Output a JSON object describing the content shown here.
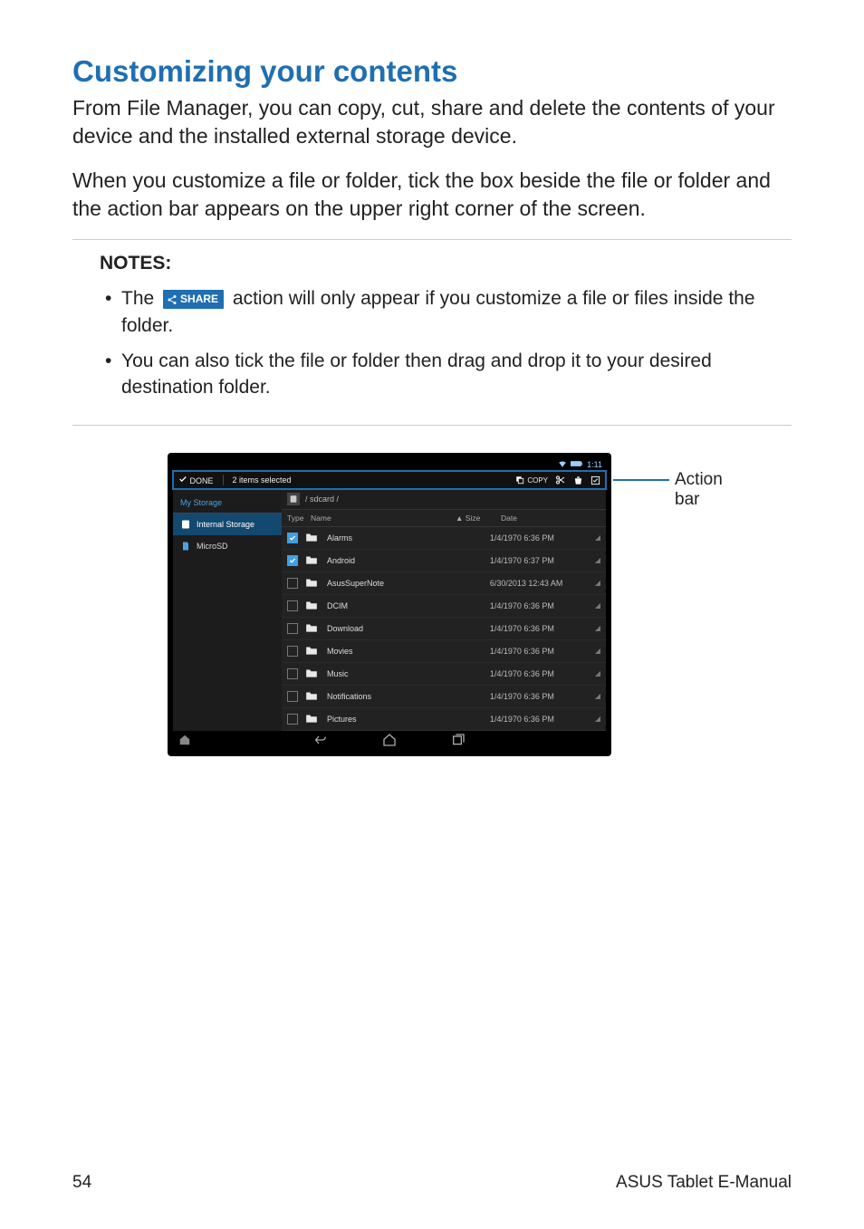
{
  "heading": "Customizing your contents",
  "para1": "From File Manager, you can copy, cut, share and delete the contents of your device and the installed external storage device.",
  "para2": "When you customize a file or folder, tick the box beside the file or folder and the action bar appears on the upper right corner of the screen.",
  "notes": {
    "title": "NOTES:",
    "bullet": "•",
    "n1a": "The",
    "share_btn": "SHARE",
    "n1b": "action will only appear if you customize a file or files inside the folder.",
    "n2": "You can also tick the file or folder then drag and drop it to your desired destination folder."
  },
  "callout": "Action bar",
  "device": {
    "status_time": "1:11",
    "sel_done": "DONE",
    "sel_count": "2 items selected",
    "act_copy": "COPY",
    "side_title": "My Storage",
    "side_internal": "Internal Storage",
    "side_sd": "MicroSD",
    "path": "/ sdcard /",
    "hdr_type": "Type",
    "hdr_name": "Name",
    "hdr_size": "Size",
    "hdr_date": "Date",
    "sort_caret": "▲",
    "rows": [
      {
        "checked": true,
        "name": "Alarms",
        "date": "1/4/1970 6:36 PM"
      },
      {
        "checked": true,
        "name": "Android",
        "date": "1/4/1970 6:37 PM"
      },
      {
        "checked": false,
        "name": "AsusSuperNote",
        "date": "6/30/2013 12:43 AM"
      },
      {
        "checked": false,
        "name": "DCIM",
        "date": "1/4/1970 6:36 PM"
      },
      {
        "checked": false,
        "name": "Download",
        "date": "1/4/1970 6:36 PM"
      },
      {
        "checked": false,
        "name": "Movies",
        "date": "1/4/1970 6:36 PM"
      },
      {
        "checked": false,
        "name": "Music",
        "date": "1/4/1970 6:36 PM"
      },
      {
        "checked": false,
        "name": "Notifications",
        "date": "1/4/1970 6:36 PM"
      },
      {
        "checked": false,
        "name": "Pictures",
        "date": "1/4/1970 6:36 PM"
      }
    ]
  },
  "footer": {
    "page": "54",
    "manual": "ASUS Tablet E-Manual"
  }
}
